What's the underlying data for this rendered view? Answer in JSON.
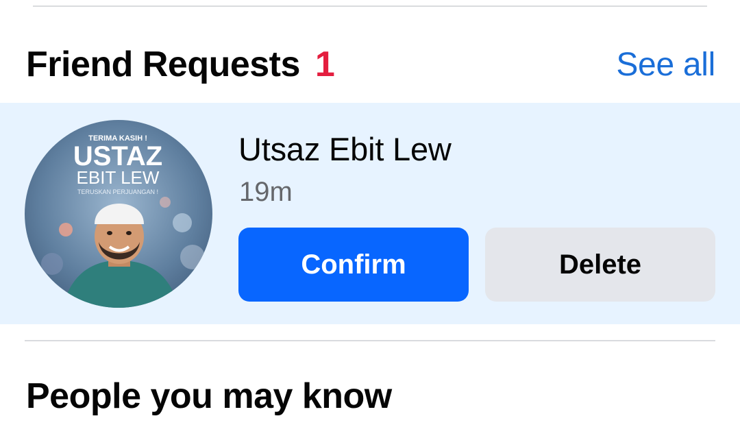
{
  "friend_requests": {
    "title": "Friend Requests",
    "count": "1",
    "see_all_label": "See all",
    "items": [
      {
        "name": "Utsaz Ebit Lew",
        "time": "19m",
        "confirm_label": "Confirm",
        "delete_label": "Delete",
        "avatar_text": {
          "line1": "TERIMA KASIH !",
          "line2": "USTAZ",
          "line3": "EBIT LEW",
          "line4": "TERUSKAN PERJUANGAN !"
        }
      }
    ]
  },
  "people_you_may_know": {
    "title": "People you may know"
  },
  "colors": {
    "accent_blue": "#0866ff",
    "link_blue": "#1a6ed8",
    "count_red": "#e41e3f",
    "card_highlight": "#e7f3ff",
    "secondary_button": "#e4e6eb"
  }
}
